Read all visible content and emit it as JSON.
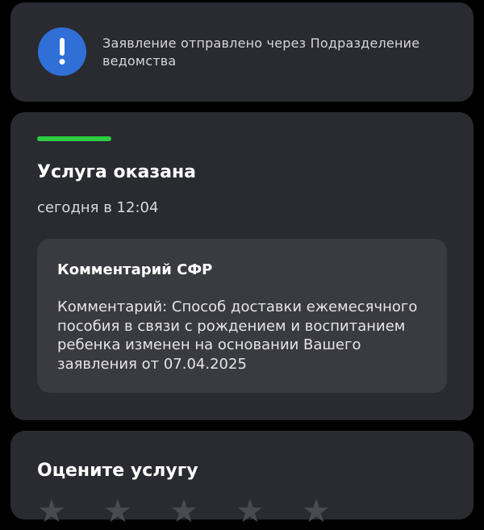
{
  "notice": {
    "text": "Заявление отправлено через Подразделение ведомства",
    "icon": "exclamation-icon",
    "icon_color": "#2f6fd6"
  },
  "status": {
    "progress_color": "#2ecc40",
    "title": "Услуга оказана",
    "time": "сегодня в 12:04",
    "comment": {
      "title": "Комментарий СФР",
      "body": "Комментарий: Способ доставки ежемесячного пособия в связи с рождением и воспитанием ребенка изменен на основании Вашего заявления от 07.04.2025"
    }
  },
  "rating": {
    "title": "Оцените услугу",
    "stars": 5
  }
}
